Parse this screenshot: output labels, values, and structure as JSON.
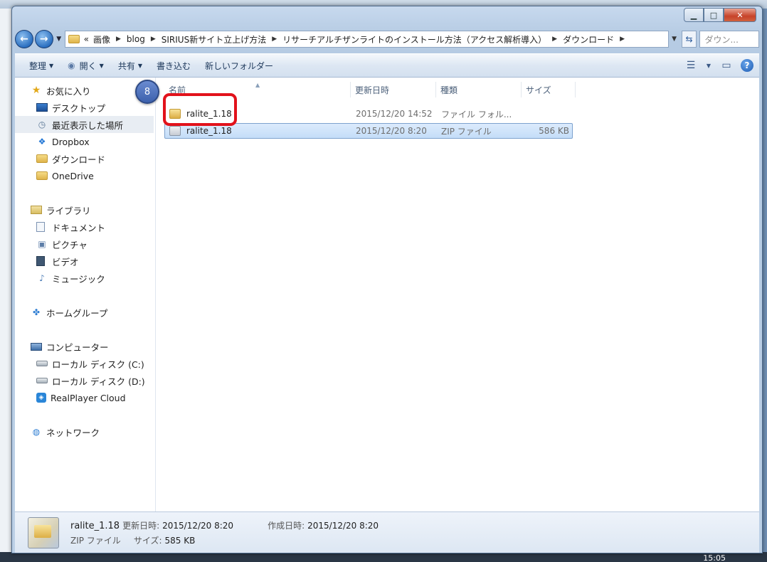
{
  "window": {
    "minimize_label": "▁",
    "maximize_label": "□",
    "close_label": "✕"
  },
  "address": {
    "overflow": "«",
    "crumbs": [
      "画像",
      "blog",
      "SIRIUS新サイト立上げ方法",
      "リサーチアルチザンライトのインストール方法（アクセス解析導入）",
      "ダウンロード"
    ],
    "search_placeholder": "ダウン..."
  },
  "toolbar": {
    "organize": "整理",
    "open": "開く",
    "share": "共有",
    "burn": "書き込む",
    "new_folder": "新しいフォルダー"
  },
  "nav": {
    "favorites": "お気に入り",
    "desktop": "デスクトップ",
    "recent": "最近表示した場所",
    "dropbox": "Dropbox",
    "downloads": "ダウンロード",
    "onedrive": "OneDrive",
    "libraries": "ライブラリ",
    "documents": "ドキュメント",
    "pictures": "ピクチャ",
    "videos": "ビデオ",
    "music": "ミュージック",
    "homegroup": "ホームグループ",
    "computer": "コンピューター",
    "disk_c": "ローカル ディスク (C:)",
    "disk_d": "ローカル ディスク (D:)",
    "realplayer": "RealPlayer Cloud",
    "network": "ネットワーク"
  },
  "columns": {
    "name": "名前",
    "date": "更新日時",
    "type": "種類",
    "size": "サイズ"
  },
  "files": [
    {
      "name": "ralite_1.18",
      "date": "2015/12/20 14:52",
      "type": "ファイル フォル...",
      "size": "",
      "icon": "folder-icon"
    },
    {
      "name": "ralite_1.18",
      "date": "2015/12/20 8:20",
      "type": "ZIP ファイル",
      "size": "586 KB",
      "icon": "zip-icon"
    }
  ],
  "annotation": {
    "step": "8",
    "color": "#e2121b"
  },
  "details": {
    "name": "ralite_1.18",
    "modified_label": "更新日時:",
    "modified_value": "2015/12/20 8:20",
    "created_label": "作成日時:",
    "created_value": "2015/12/20 8:20",
    "type": "ZIP ファイル",
    "size_label": "サイズ:",
    "size_value": "585 KB"
  },
  "taskbar": {
    "clock": "15:05"
  }
}
